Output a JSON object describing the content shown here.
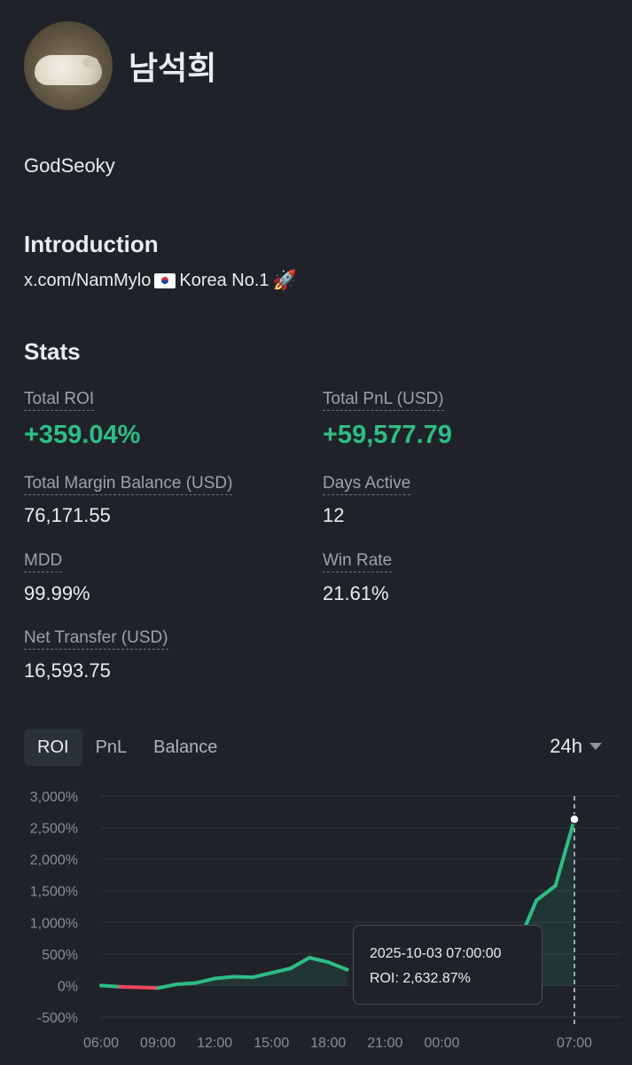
{
  "profile": {
    "name": "남석희",
    "handle": "GodSeoky"
  },
  "introduction": {
    "title": "Introduction",
    "text": "x.com/NamMylo",
    "flag_icon": "korea-flag-icon",
    "text_after_flag": "Korea No.1",
    "rocket_icon": "rocket-icon"
  },
  "stats": {
    "title": "Stats",
    "total_roi": {
      "label": "Total ROI",
      "value": "+359.04%"
    },
    "total_pnl": {
      "label": "Total PnL (USD)",
      "value": "+59,577.79"
    },
    "margin_balance": {
      "label": "Total Margin Balance (USD)",
      "value": "76,171.55"
    },
    "days_active": {
      "label": "Days Active",
      "value": "12"
    },
    "mdd": {
      "label": "MDD",
      "value": "99.99%"
    },
    "win_rate": {
      "label": "Win Rate",
      "value": "21.61%"
    },
    "net_transfer": {
      "label": "Net Transfer (USD)",
      "value": "16,593.75"
    }
  },
  "chart_tabs": [
    {
      "label": "ROI",
      "active": true
    },
    {
      "label": "PnL",
      "active": false
    },
    {
      "label": "Balance",
      "active": false
    }
  ],
  "range": {
    "label": "24h"
  },
  "tooltip": {
    "time": "2025-10-03 07:00:00",
    "value": "ROI: 2,632.87%"
  },
  "colors": {
    "positive": "#2ebd85",
    "negative": "#f6465d",
    "background": "#1f2329"
  },
  "chart_data": {
    "type": "line",
    "y_tick_labels": [
      "3,000%",
      "2,500%",
      "2,000%",
      "1,500%",
      "1,000%",
      "500%",
      "0%",
      "-500%"
    ],
    "y_ticks": [
      3000,
      2500,
      2000,
      1500,
      1000,
      500,
      0,
      -500
    ],
    "ylim": [
      -500,
      3000
    ],
    "x_tick_labels": [
      "06:00",
      "09:00",
      "12:00",
      "15:00",
      "18:00",
      "21:00",
      "00:00",
      "07:00"
    ],
    "x_tick_hours": [
      0,
      3,
      6,
      9,
      12,
      15,
      18,
      25
    ],
    "xlim": [
      0,
      25
    ],
    "series": [
      {
        "x": [
          0,
          1,
          2,
          3,
          4,
          5,
          6,
          7,
          8,
          9,
          10,
          11,
          12,
          13
        ],
        "y": [
          0,
          -20,
          -30,
          -40,
          20,
          40,
          110,
          140,
          130,
          200,
          270,
          440,
          370,
          250
        ]
      },
      {
        "x": [
          21,
          22,
          23,
          24,
          25
        ],
        "y": [
          380,
          650,
          1350,
          1580,
          2632.87
        ]
      }
    ],
    "highlight": {
      "x": 25,
      "y": 2632.87
    },
    "grid": true
  }
}
